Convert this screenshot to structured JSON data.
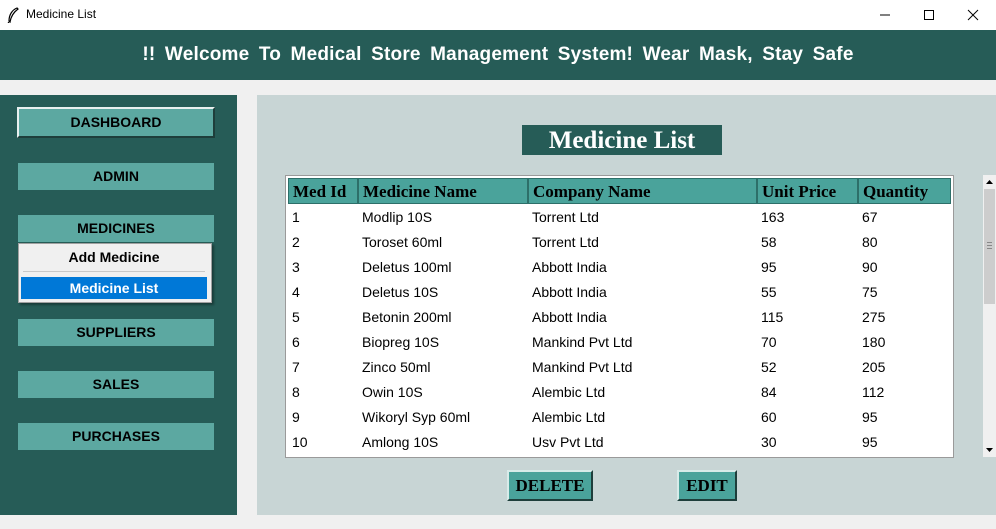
{
  "window": {
    "title": "Medicine List",
    "icons": [
      "feather-icon",
      "minimize-icon",
      "maximize-icon",
      "close-icon"
    ]
  },
  "banner": {
    "text": "!!  Welcome To Medical Store Management System! Wear Mask, Stay Safe"
  },
  "sidebar": {
    "items": [
      {
        "label": "DASHBOARD"
      },
      {
        "label": "ADMIN"
      },
      {
        "label": "MEDICINES"
      },
      {
        "label": "SUPPLIERS"
      },
      {
        "label": "SALES"
      },
      {
        "label": "PURCHASES"
      }
    ],
    "menu": {
      "items": [
        {
          "label": "Add Medicine",
          "selected": false
        },
        {
          "label": "Medicine List",
          "selected": true
        }
      ]
    }
  },
  "content": {
    "title": "Medicine List",
    "table": {
      "columns": [
        "Med Id",
        "Medicine Name",
        "Company Name",
        "Unit Price",
        "Quantity"
      ],
      "rows": [
        [
          "1",
          "Modlip 10S",
          "Torrent Ltd",
          "163",
          "67"
        ],
        [
          "2",
          "Toroset 60ml",
          "Torrent Ltd",
          "58",
          "80"
        ],
        [
          "3",
          "Deletus 100ml",
          "Abbott India",
          "95",
          "90"
        ],
        [
          "4",
          "Deletus 10S",
          "Abbott India",
          "55",
          "75"
        ],
        [
          "5",
          "Betonin 200ml",
          "Abbott India",
          "115",
          "275"
        ],
        [
          "6",
          "Biopreg 10S",
          "Mankind Pvt Ltd",
          "70",
          "180"
        ],
        [
          "7",
          "Zinco 50ml",
          "Mankind Pvt Ltd",
          "52",
          "205"
        ],
        [
          "8",
          "Owin 10S",
          "Alembic Ltd",
          "84",
          "112"
        ],
        [
          "9",
          "Wikoryl Syp 60ml",
          "Alembic Ltd",
          "60",
          "95"
        ],
        [
          "10",
          "Amlong 10S",
          "Usv Pvt Ltd",
          "30",
          "95"
        ]
      ]
    },
    "buttons": {
      "delete": "DELETE",
      "edit": "EDIT"
    }
  },
  "colors": {
    "banner": "#265c57",
    "sidebar": "#265c57",
    "nav_button": "#5ca8a1",
    "content_bg": "#c8d5d5",
    "header_cell": "#4aa39b",
    "menu_highlight": "#0078d7"
  }
}
